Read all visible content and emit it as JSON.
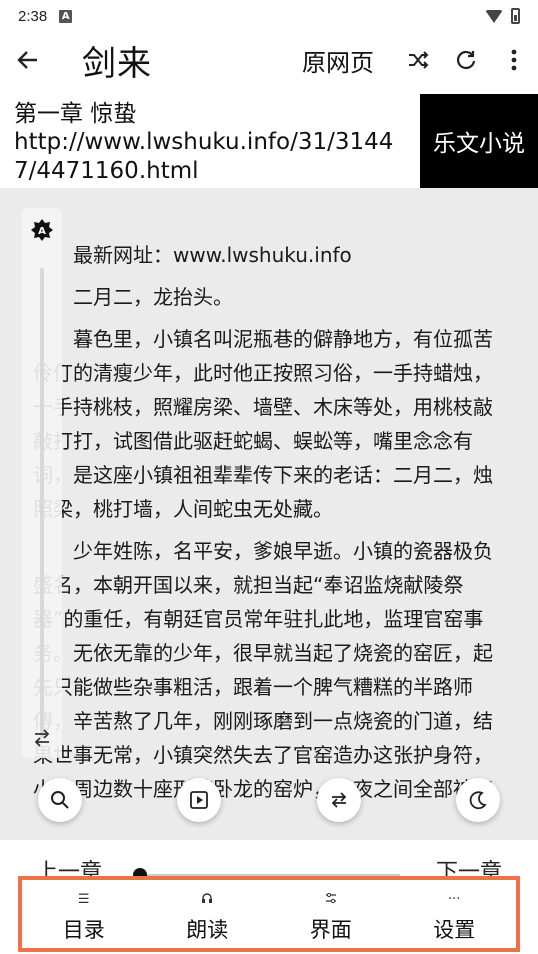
{
  "status_bar": {
    "time": "2:38",
    "notif_icon": "A"
  },
  "app_bar": {
    "title": "剑来",
    "source_page_label": "原网页"
  },
  "chapter": {
    "title": "第一章 惊蛰",
    "url": "http://www.lwshuku.info/31/31447/4471160.html",
    "source_name": "乐文小说"
  },
  "content": {
    "lead": "最新网址：www.lwshuku.info",
    "paragraphs": [
      "二月二，龙抬头。",
      "暮色里，小镇名叫泥瓶巷的僻静地方，有位孤苦伶仃的清瘦少年，此时他正按照习俗，一手持蜡烛，一手持桃枝，照耀房梁、墙壁、木床等处，用桃枝敲敲打打，试图借此驱赶蛇蝎、蜈蚣等，嘴里念念有词，是这座小镇祖祖辈辈传下来的老话：二月二，烛照梁，桃打墙，人间蛇虫无处藏。",
      "少年姓陈，名平安，爹娘早逝。小镇的瓷器极负盛名，本朝开国以来，就担当起“奉诏监烧献陵祭器”的重任，有朝廷官员常年驻扎此地，监理官窑事务。无依无靠的少年，很早就当起了烧瓷的窑匠，起先只能做些杂事粗活，跟着一个脾气糟糕的半路师傅，辛苦熬了几年，刚刚琢磨到一点烧瓷的门道，结果世事无常，小镇突然失去了官窑造办这张护身符，小镇周边数十座形若卧龙的窑炉，一夜之间全部被官"
    ]
  },
  "navigation": {
    "prev_label": "上一章",
    "next_label": "下一章",
    "progress": 0.0
  },
  "menu": [
    {
      "label": "目录",
      "icon": "list-icon"
    },
    {
      "label": "朗读",
      "icon": "headphones-icon"
    },
    {
      "label": "界面",
      "icon": "sliders-icon"
    },
    {
      "label": "设置",
      "icon": "more-icon"
    }
  ],
  "colors": {
    "menu_highlight": "#f0704a",
    "reader_bg": "#ebebeb"
  }
}
